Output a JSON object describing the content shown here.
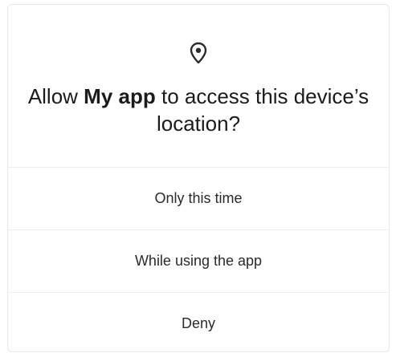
{
  "dialog": {
    "icon": "location-pin-icon",
    "title_prefix": "Allow ",
    "app_name": "My app",
    "title_suffix": " to access this device’s location?",
    "options": [
      {
        "label": "Only this time"
      },
      {
        "label": "While using the app"
      },
      {
        "label": "Deny"
      }
    ]
  },
  "colors": {
    "text": "#1b1b1b",
    "background": "#ffffff",
    "divider": "#eeeeee"
  }
}
